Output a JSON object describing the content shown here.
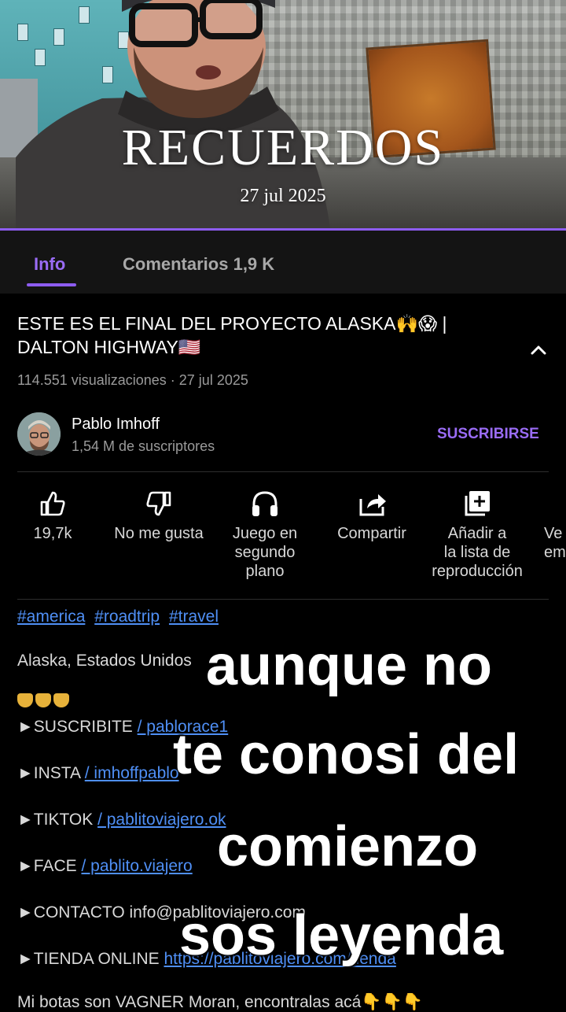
{
  "memories": {
    "title": "RECUERDOS",
    "date": "27 jul 2025"
  },
  "tabs": [
    {
      "label": "Info",
      "active": true
    },
    {
      "label": "Comentarios 1,9 K",
      "active": false
    }
  ],
  "video": {
    "title_line1": "ESTE ES EL FINAL DEL PROYECTO ALASKA🙌😱 |",
    "title_line2": "DALTON HIGHWAY🇺🇸",
    "meta": "114.551 visualizaciones · 27 jul 2025"
  },
  "channel": {
    "name": "Pablo Imhoff",
    "subscribers": "1,54 M de suscriptores",
    "subscribe_label": "SUSCRIBIRSE"
  },
  "actions": [
    {
      "icon": "thumbs-up-icon",
      "label": "19,7k"
    },
    {
      "icon": "thumbs-down-icon",
      "label": "No me gusta"
    },
    {
      "icon": "headphones-icon",
      "label_lines": [
        "Juego en",
        "segundo",
        "plano"
      ]
    },
    {
      "icon": "share-icon",
      "label": "Compartir"
    },
    {
      "icon": "add-to-playlist-icon",
      "label_lines": [
        "Añadir a",
        "la lista de",
        "reproducción"
      ]
    },
    {
      "icon": "more-icon",
      "label_lines": [
        "Ve",
        "em"
      ]
    }
  ],
  "description": {
    "hashtags": [
      "#america",
      "#roadtrip",
      "#travel"
    ],
    "location": "Alaska, Estados Unidos",
    "emoji_row": "👇👇👇",
    "links": [
      {
        "prefix": "►SUSCRIBITE ",
        "link": " / pablorace1 "
      },
      {
        "prefix": "►INSTA ",
        "link": " / imhoffpablo "
      },
      {
        "prefix": "►TIKTOK ",
        "link": " / pablitoviajero.ok "
      },
      {
        "prefix": "►FACE ",
        "link": " / pablito.viajero "
      }
    ],
    "contact": "►CONTACTO info@pablitoviajero.com",
    "store_prefix": "►TIENDA ONLINE ",
    "store_link": "https://pablitoviajero.com/tienda",
    "boots": "Mi botas son VAGNER Moran, encontralas acá👇👇👇"
  },
  "overlay": {
    "line1": "aunque no",
    "line2": "te conosi del",
    "line3": "comienzo",
    "line4": "sos  leyenda"
  },
  "colors": {
    "accent": "#8d5cf0",
    "link": "#4f8ff5",
    "background": "#000000"
  }
}
